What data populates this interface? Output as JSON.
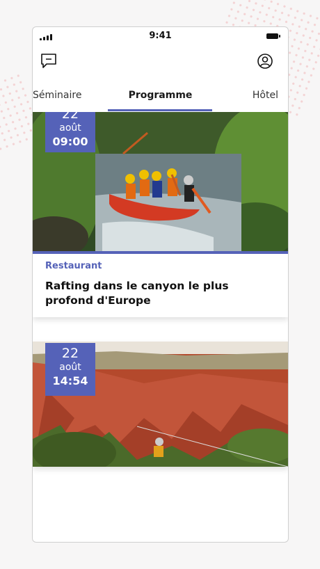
{
  "status_bar": {
    "time": "9:41"
  },
  "top_bar": {
    "chat_icon": "chat-bubble-icon",
    "profile_icon": "user-circle-icon"
  },
  "tabs": [
    {
      "label": "Séminaire"
    },
    {
      "label": "Programme",
      "active": true
    },
    {
      "label": "Hôtel"
    }
  ],
  "events": [
    {
      "day": "22",
      "month": "août",
      "time": "09:00",
      "category": "Restaurant",
      "title": "Rafting dans le canyon le plus profond d'Europe",
      "image": "rafting-photo"
    },
    {
      "day": "22",
      "month": "août",
      "time": "14:54",
      "image": "canyon-zipline-photo"
    }
  ],
  "colors": {
    "accent": "#5562b8"
  }
}
